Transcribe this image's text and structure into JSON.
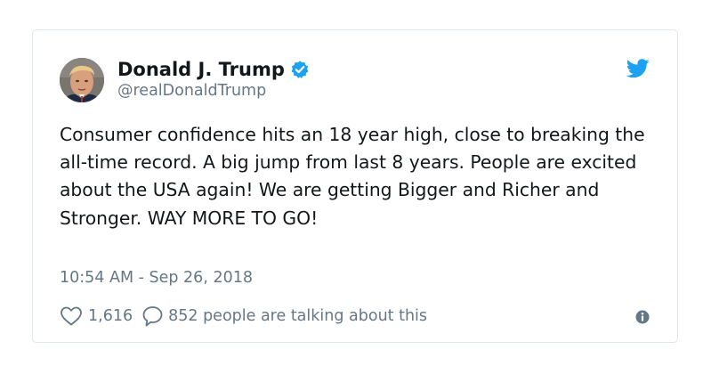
{
  "tweet": {
    "display_name": "Donald J. Trump",
    "handle": "@realDonaldTrump",
    "verified": true,
    "text": "Consumer confidence hits an 18 year high, close to breaking the all-time record. A big jump from last 8 years. People are excited about the USA again! We are getting Bigger and Richer and Stronger. WAY MORE TO GO!",
    "timestamp": "10:54 AM - Sep 26, 2018",
    "like_count": "1,616",
    "talking_text": "852 people are talking about this"
  },
  "icons": {
    "avatar": "profile-photo",
    "verified": "verified-badge-icon",
    "brand": "twitter-bird-icon",
    "like": "heart-icon",
    "reply": "speech-bubble-icon",
    "info": "info-icon"
  },
  "colors": {
    "accent": "#1da1f2",
    "text": "#14171a",
    "muted": "#657786",
    "border": "#e1e8ed"
  }
}
